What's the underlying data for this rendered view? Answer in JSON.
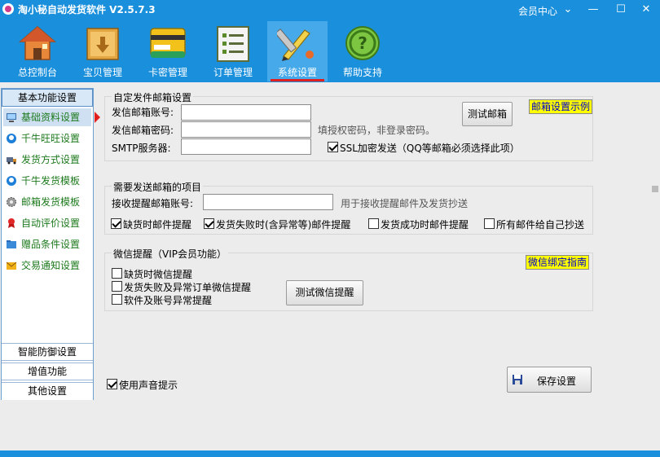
{
  "titlebar": {
    "title": "淘小秘自动发货软件 V2.5.7.3",
    "member_center": "会员中心",
    "dropdown_glyph": "⌄",
    "minimize_glyph": "—",
    "maximize_glyph": "☐",
    "close_glyph": "✕"
  },
  "nav": {
    "tabs": [
      {
        "label": "总控制台",
        "icon": "house-icon"
      },
      {
        "label": "宝贝管理",
        "icon": "box-icon"
      },
      {
        "label": "卡密管理",
        "icon": "card-icon"
      },
      {
        "label": "订单管理",
        "icon": "list-icon"
      },
      {
        "label": "系统设置",
        "icon": "tools-icon"
      },
      {
        "label": "帮助支持",
        "icon": "help-icon"
      }
    ],
    "active_index": 4
  },
  "sidebar": {
    "head_basic": "基本功能设置",
    "items": [
      {
        "label": "基础资料设置",
        "icon": "computer-icon"
      },
      {
        "label": "千牛旺旺设置",
        "icon": "qianniu-icon"
      },
      {
        "label": "发货方式设置",
        "icon": "truck-icon"
      },
      {
        "label": "千牛发货模板",
        "icon": "qianniu-icon"
      },
      {
        "label": "邮箱发货模板",
        "icon": "gear-icon"
      },
      {
        "label": "自动评价设置",
        "icon": "award-icon"
      },
      {
        "label": "赠品条件设置",
        "icon": "folder-icon"
      },
      {
        "label": "交易通知设置",
        "icon": "mail-icon"
      }
    ],
    "selected_index": 0,
    "head_defense": "智能防御设置",
    "head_value": "增值功能",
    "head_other": "其他设置"
  },
  "sender": {
    "title": "自定发件邮箱设置",
    "account_label": "发信邮箱账号:",
    "account_value": "",
    "password_label": "发信邮箱密码:",
    "password_value": "",
    "password_hint": "填授权密码，非登录密码。",
    "smtp_label": "SMTP服务器:",
    "smtp_value": "",
    "ssl_label": "SSL加密发送（QQ等邮箱必须选择此项）",
    "ssl_checked": true,
    "test_button": "测试邮箱",
    "example_link": "邮箱设置示例"
  },
  "notify_mail": {
    "title": "需要发送邮箱的项目",
    "receive_label": "接收提醒邮箱账号:",
    "receive_value": "",
    "receive_hint": "用于接收提醒邮件及发货抄送",
    "options": [
      {
        "label": "缺货时邮件提醒",
        "checked": true
      },
      {
        "label": "发货失败时(含异常等)邮件提醒",
        "checked": true
      },
      {
        "label": "发货成功时邮件提醒",
        "checked": false
      },
      {
        "label": "所有邮件给自己抄送",
        "checked": false
      }
    ]
  },
  "wechat": {
    "title": "微信提醒（VIP会员功能）",
    "guide_link": "微信绑定指南",
    "options": [
      {
        "label": "缺货时微信提醒",
        "checked": false
      },
      {
        "label": "发货失败及异常订单微信提醒",
        "checked": false
      },
      {
        "label": "软件及账号异常提醒",
        "checked": false
      }
    ],
    "test_button": "测试微信提醒"
  },
  "footer": {
    "sound_label": "使用声音提示",
    "sound_checked": true,
    "save_button": "保存设置"
  },
  "colors": {
    "toolbar_bg": "#1a8fdc",
    "active_underline": "#e02020",
    "sidebar_text": "#1d7a1d",
    "link_highlight": "#ffff00"
  }
}
